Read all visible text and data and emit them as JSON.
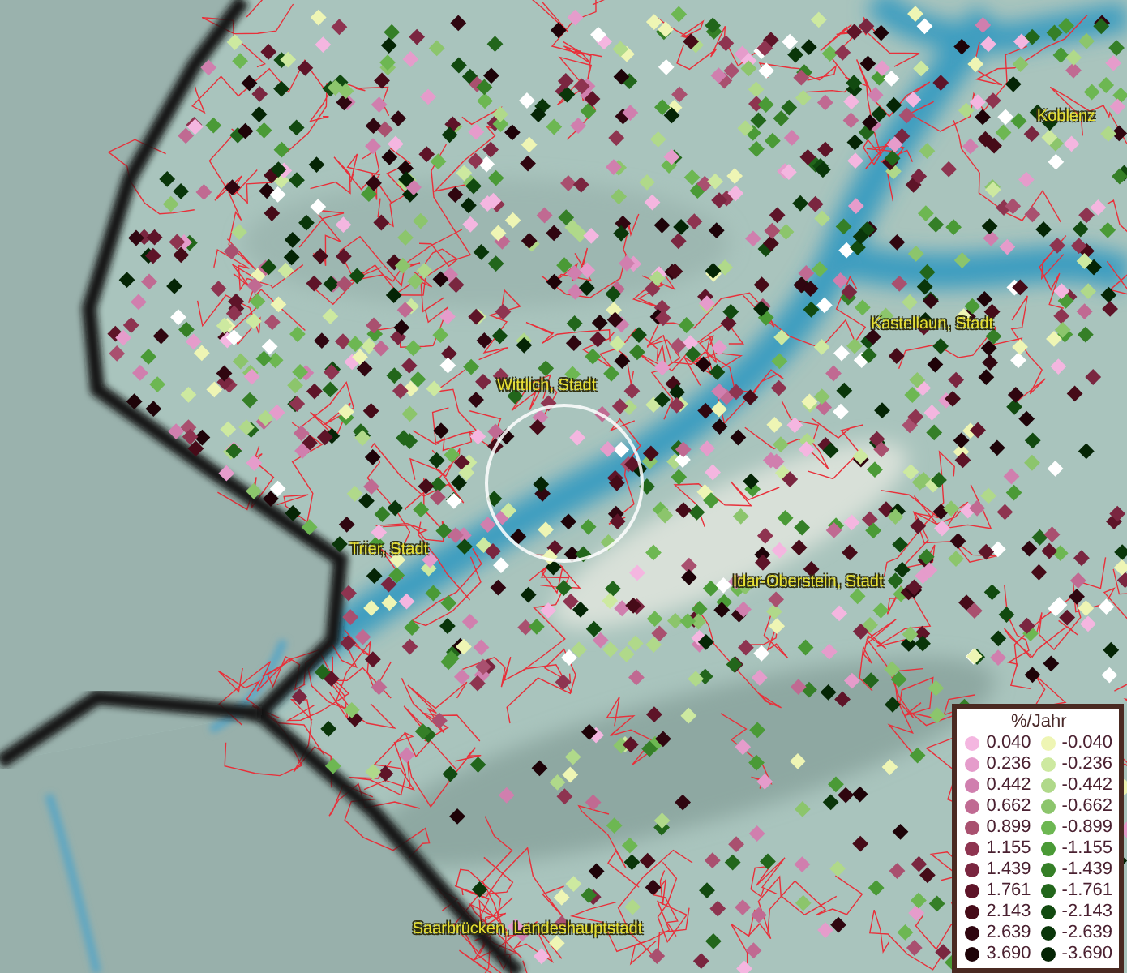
{
  "map": {
    "places": [
      {
        "name": "Koblenz"
      },
      {
        "name": "Kastellaun, Stadt"
      },
      {
        "name": "Wittlich, Stadt"
      },
      {
        "name": "Trier, Stadt"
      },
      {
        "name": "Idar-Oberstein, Stadt"
      },
      {
        "name": "Saarbrücken, Landeshauptstadt"
      }
    ]
  },
  "legend": {
    "title": "%/Jahr",
    "items": [
      {
        "label": "0.040",
        "color": "#f4b6e0"
      },
      {
        "label": "0.236",
        "color": "#e59ccb"
      },
      {
        "label": "0.442",
        "color": "#d07fae"
      },
      {
        "label": "0.662",
        "color": "#c06a92"
      },
      {
        "label": "0.899",
        "color": "#a9506f"
      },
      {
        "label": "1.155",
        "color": "#8e3450"
      },
      {
        "label": "1.439",
        "color": "#7a2640"
      },
      {
        "label": "1.761",
        "color": "#5e1428"
      },
      {
        "label": "2.143",
        "color": "#460b18"
      },
      {
        "label": "2.639",
        "color": "#300610"
      },
      {
        "label": "3.690",
        "color": "#1e0308"
      },
      {
        "label": "-0.040",
        "color": "#eef5b4"
      },
      {
        "label": "-0.236",
        "color": "#cde9a0"
      },
      {
        "label": "-0.442",
        "color": "#b0d98a"
      },
      {
        "label": "-0.662",
        "color": "#8cc56c"
      },
      {
        "label": "-0.899",
        "color": "#6db752"
      },
      {
        "label": "-1.155",
        "color": "#4a9a36"
      },
      {
        "label": "-1.439",
        "color": "#357f27"
      },
      {
        "label": "-1.761",
        "color": "#22661b"
      },
      {
        "label": "-2.143",
        "color": "#124a10"
      },
      {
        "label": "-2.639",
        "color": "#0a360a"
      },
      {
        "label": "-3.690",
        "color": "#052505"
      }
    ]
  }
}
